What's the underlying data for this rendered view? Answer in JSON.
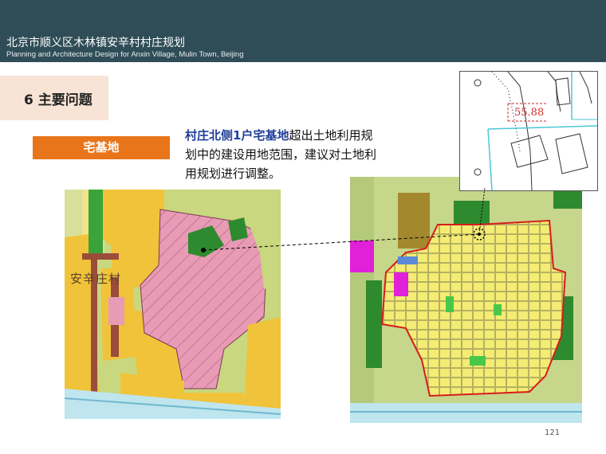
{
  "header": {
    "title": "北京市顺义区木林镇安辛村村庄规划",
    "subtitle": "Planning and Architecture Design for Anxin Village, Mulin Town, Beijing"
  },
  "section": {
    "title": "6  主要问题"
  },
  "tag": {
    "label": "宅基地"
  },
  "description": {
    "highlight": "村庄北侧1户宅基地",
    "rest": "超出土地利用规划中的建设用地范围，建议对土地利用规划进行调整。"
  },
  "left_map": {
    "village_label": "安辛庄村"
  },
  "inset_map": {
    "value_label": "55.88"
  },
  "footer": {
    "page_number": "121"
  },
  "colors": {
    "header_bg": "#2f4d57",
    "section_bg": "#f8e4d6",
    "tag_bg": "#e8751a",
    "highlight_text": "#1f3f99"
  }
}
